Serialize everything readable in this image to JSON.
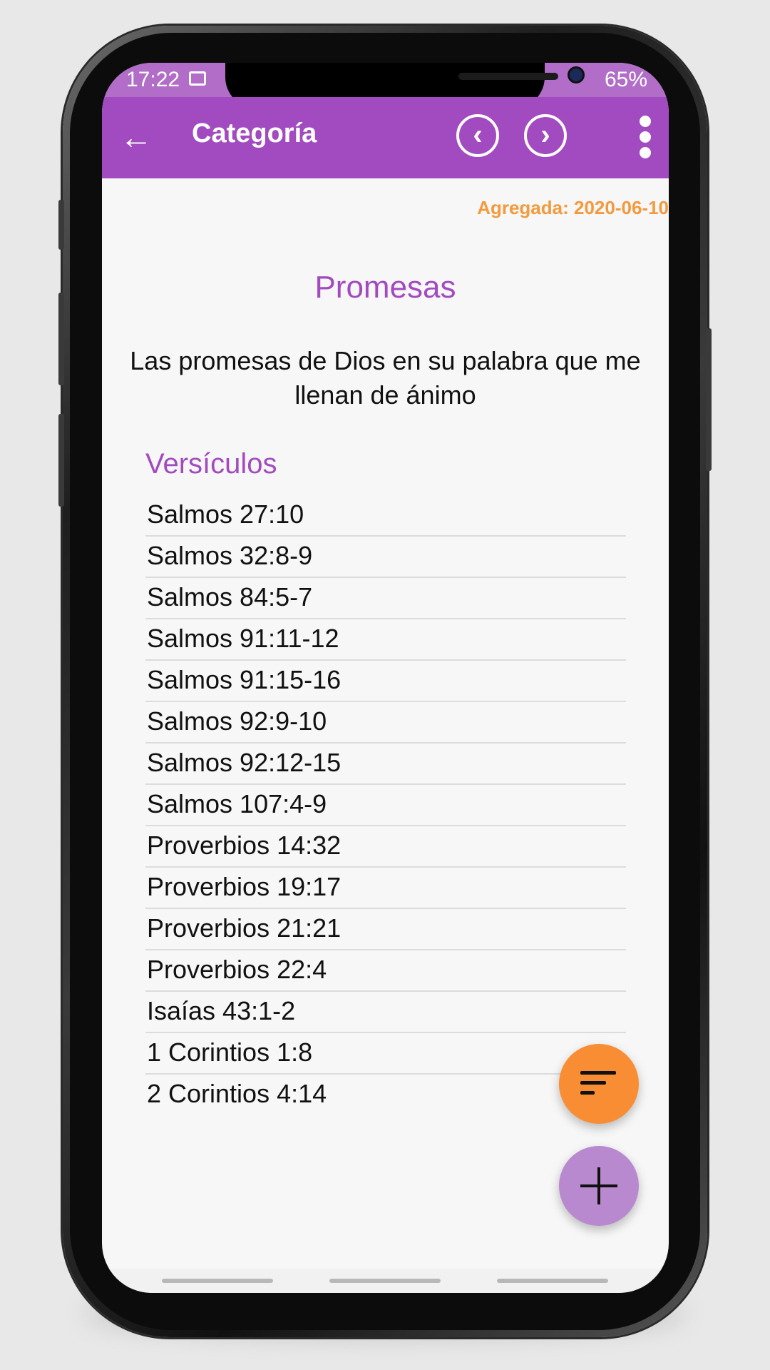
{
  "status_bar": {
    "time": "17:22",
    "right": "65%"
  },
  "toolbar": {
    "title": "Categoría",
    "prev": "‹",
    "next": "›"
  },
  "added_label": "Agregada: 2020-06-10",
  "category": {
    "name": "Promesas",
    "description": "Las promesas de Dios en su palabra que me llenan de ánimo"
  },
  "section_title": "Versículos",
  "verses": [
    "Salmos 27:10",
    "Salmos 32:8-9",
    "Salmos 84:5-7",
    "Salmos 91:11-12",
    "Salmos 91:15-16",
    "Salmos 92:9-10",
    "Salmos 92:12-15",
    "Salmos 107:4-9",
    "Proverbios 14:32",
    "Proverbios 19:17",
    "Proverbios 21:21",
    "Proverbios 22:4",
    "Isaías 43:1-2",
    "1 Corintios 1:8",
    "2 Corintios 4:14"
  ],
  "colors": {
    "toolbar": "#a24bc0",
    "accent_orange": "#f98d34",
    "fab_add": "#b889cf"
  },
  "icons": {
    "back": "arrow-left-icon",
    "sort": "sort-icon",
    "add": "plus-icon",
    "more": "more-vertical-icon"
  }
}
